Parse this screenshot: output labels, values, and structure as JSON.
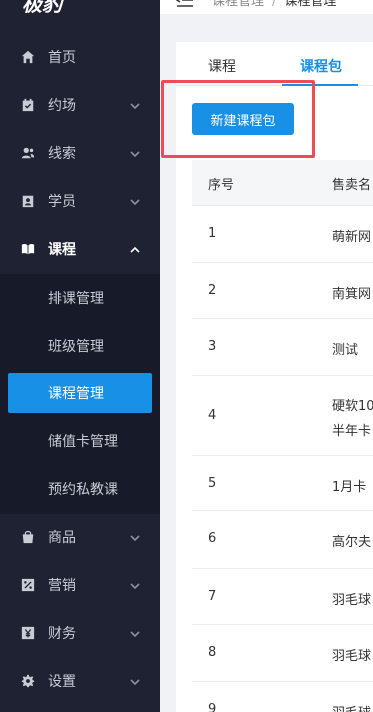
{
  "app": {
    "logo_text": "极豹"
  },
  "header": {
    "breadcrumb": [
      "课程管理",
      "课程管理"
    ],
    "separator": "/"
  },
  "sidebar": {
    "items": [
      {
        "label": "首页",
        "icon": "home-icon",
        "has_children": false
      },
      {
        "label": "约场",
        "icon": "calendar-check-icon",
        "has_children": true
      },
      {
        "label": "线索",
        "icon": "users-icon",
        "has_children": true
      },
      {
        "label": "学员",
        "icon": "id-card-icon",
        "has_children": true
      },
      {
        "label": "课程",
        "icon": "book-icon",
        "has_children": true,
        "open": true
      },
      {
        "label": "商品",
        "icon": "shopping-bag-icon",
        "has_children": true
      },
      {
        "label": "营销",
        "icon": "percent-icon",
        "has_children": true
      },
      {
        "label": "财务",
        "icon": "yen-icon",
        "has_children": true
      },
      {
        "label": "设置",
        "icon": "gear-icon",
        "has_children": true
      }
    ],
    "course_submenu": [
      {
        "label": "排课管理",
        "active": false
      },
      {
        "label": "班级管理",
        "active": false
      },
      {
        "label": "课程管理",
        "active": true
      },
      {
        "label": "储值卡管理",
        "active": false
      },
      {
        "label": "预约私教课",
        "active": false
      }
    ]
  },
  "main": {
    "tabs": [
      {
        "label": "课程",
        "active": false
      },
      {
        "label": "课程包",
        "active": true
      }
    ],
    "new_button_label": "新建课程包",
    "table": {
      "columns": [
        "序号",
        "售卖名"
      ],
      "rows": [
        {
          "index": "1",
          "name": "萌新网"
        },
        {
          "index": "2",
          "name": "南箕网"
        },
        {
          "index": "3",
          "name": "测试"
        },
        {
          "index": "4",
          "name": "硬软10",
          "name_line2": "半年卡"
        },
        {
          "index": "5",
          "name": "1月卡"
        },
        {
          "index": "6",
          "name": "高尔夫"
        },
        {
          "index": "7",
          "name": "羽毛球"
        },
        {
          "index": "8",
          "name": "羽毛球"
        },
        {
          "index": "9",
          "name": "羽毛球"
        }
      ]
    }
  },
  "colors": {
    "sidebar_bg": "#1f2233",
    "accent": "#1890e6",
    "highlight_border": "#ee4b55"
  }
}
